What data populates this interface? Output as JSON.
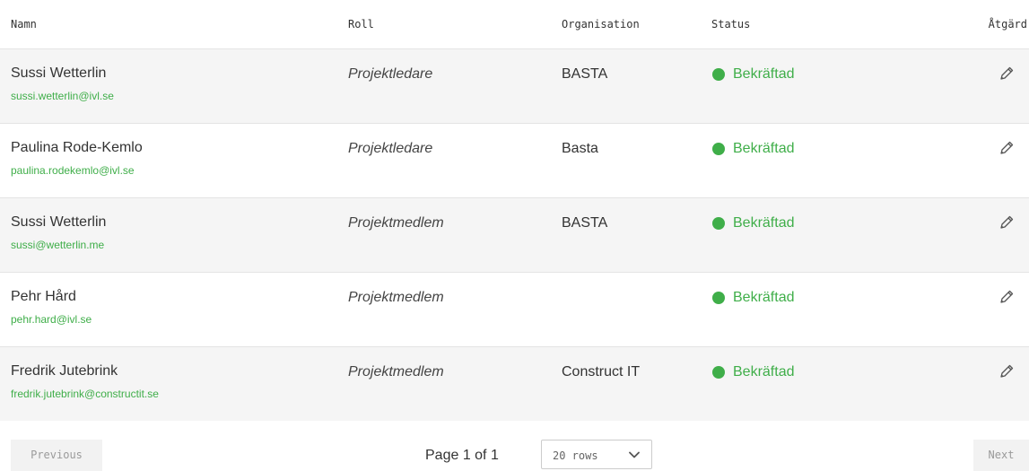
{
  "table": {
    "headers": {
      "name": "Namn",
      "role": "Roll",
      "organisation": "Organisation",
      "status": "Status",
      "action": "Åtgärd"
    },
    "rows": [
      {
        "name": "Sussi Wetterlin",
        "email": "sussi.wetterlin@ivl.se",
        "role": "Projektledare",
        "organisation": "BASTA",
        "status": "Bekräftad"
      },
      {
        "name": "Paulina Rode-Kemlo",
        "email": "paulina.rodekemlo@ivl.se",
        "role": "Projektledare",
        "organisation": "Basta",
        "status": "Bekräftad"
      },
      {
        "name": "Sussi Wetterlin",
        "email": "sussi@wetterlin.me",
        "role": "Projektmedlem",
        "organisation": "BASTA",
        "status": "Bekräftad"
      },
      {
        "name": "Pehr Hård",
        "email": "pehr.hard@ivl.se",
        "role": "Projektmedlem",
        "organisation": "",
        "status": "Bekräftad"
      },
      {
        "name": "Fredrik Jutebrink",
        "email": "fredrik.jutebrink@constructit.se",
        "role": "Projektmedlem",
        "organisation": "Construct IT",
        "status": "Bekräftad"
      }
    ],
    "action_icon": "pencil-icon",
    "status_icon": "status-dot-icon"
  },
  "pagination": {
    "previous_label": "Previous",
    "next_label": "Next",
    "page_info": "Page 1 of 1",
    "rows_per_page": "20 rows",
    "chevron_icon": "chevron-down-icon"
  },
  "colors": {
    "accent_green": "#3fae49",
    "row_stripe": "#f5f5f5",
    "divider": "#e4e4e4"
  }
}
